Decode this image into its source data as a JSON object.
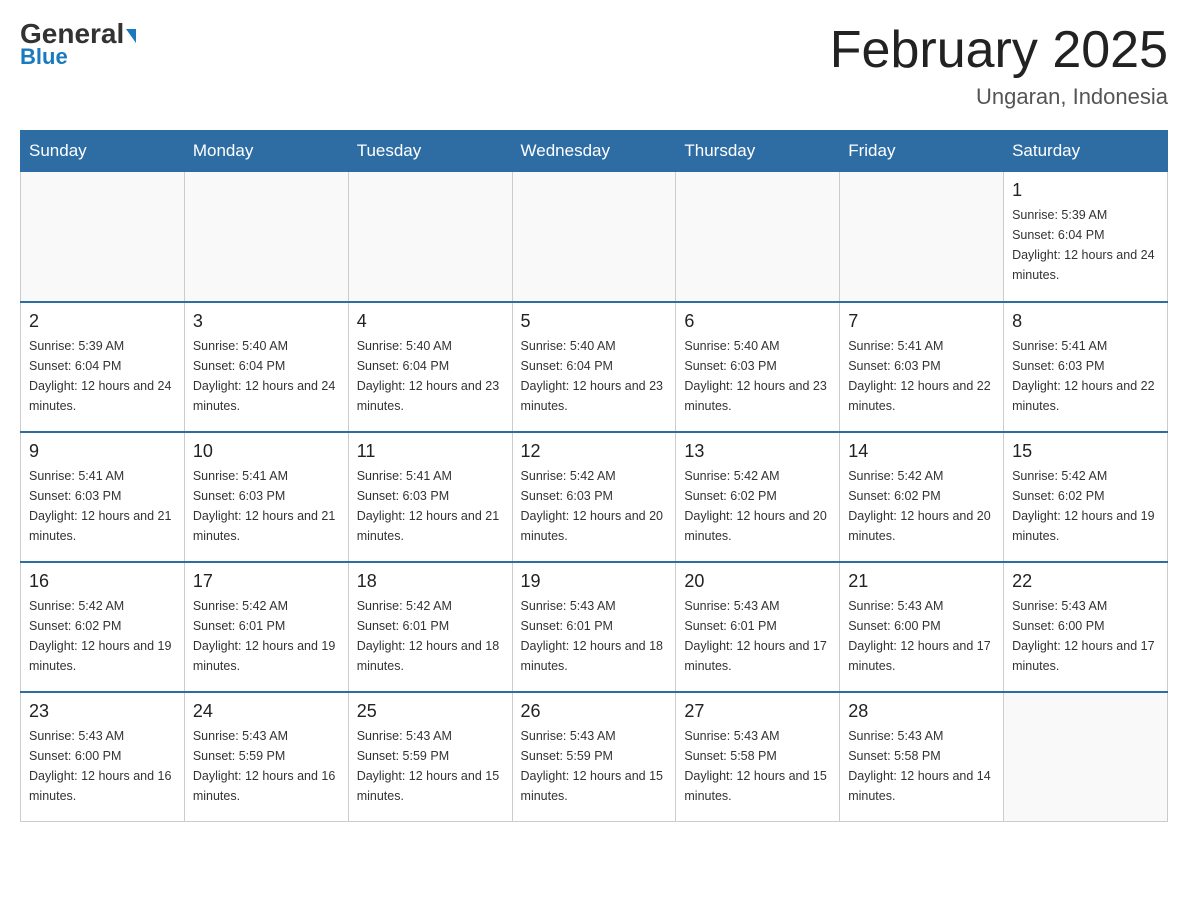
{
  "header": {
    "logo_general": "General",
    "logo_blue": "Blue",
    "month_title": "February 2025",
    "location": "Ungaran, Indonesia"
  },
  "days_of_week": [
    "Sunday",
    "Monday",
    "Tuesday",
    "Wednesday",
    "Thursday",
    "Friday",
    "Saturday"
  ],
  "weeks": [
    {
      "days": [
        {
          "date": "",
          "empty": true
        },
        {
          "date": "",
          "empty": true
        },
        {
          "date": "",
          "empty": true
        },
        {
          "date": "",
          "empty": true
        },
        {
          "date": "",
          "empty": true
        },
        {
          "date": "",
          "empty": true
        },
        {
          "date": "1",
          "sunrise": "5:39 AM",
          "sunset": "6:04 PM",
          "daylight": "12 hours and 24 minutes."
        }
      ]
    },
    {
      "days": [
        {
          "date": "2",
          "sunrise": "5:39 AM",
          "sunset": "6:04 PM",
          "daylight": "12 hours and 24 minutes."
        },
        {
          "date": "3",
          "sunrise": "5:40 AM",
          "sunset": "6:04 PM",
          "daylight": "12 hours and 24 minutes."
        },
        {
          "date": "4",
          "sunrise": "5:40 AM",
          "sunset": "6:04 PM",
          "daylight": "12 hours and 23 minutes."
        },
        {
          "date": "5",
          "sunrise": "5:40 AM",
          "sunset": "6:04 PM",
          "daylight": "12 hours and 23 minutes."
        },
        {
          "date": "6",
          "sunrise": "5:40 AM",
          "sunset": "6:03 PM",
          "daylight": "12 hours and 23 minutes."
        },
        {
          "date": "7",
          "sunrise": "5:41 AM",
          "sunset": "6:03 PM",
          "daylight": "12 hours and 22 minutes."
        },
        {
          "date": "8",
          "sunrise": "5:41 AM",
          "sunset": "6:03 PM",
          "daylight": "12 hours and 22 minutes."
        }
      ]
    },
    {
      "days": [
        {
          "date": "9",
          "sunrise": "5:41 AM",
          "sunset": "6:03 PM",
          "daylight": "12 hours and 21 minutes."
        },
        {
          "date": "10",
          "sunrise": "5:41 AM",
          "sunset": "6:03 PM",
          "daylight": "12 hours and 21 minutes."
        },
        {
          "date": "11",
          "sunrise": "5:41 AM",
          "sunset": "6:03 PM",
          "daylight": "12 hours and 21 minutes."
        },
        {
          "date": "12",
          "sunrise": "5:42 AM",
          "sunset": "6:03 PM",
          "daylight": "12 hours and 20 minutes."
        },
        {
          "date": "13",
          "sunrise": "5:42 AM",
          "sunset": "6:02 PM",
          "daylight": "12 hours and 20 minutes."
        },
        {
          "date": "14",
          "sunrise": "5:42 AM",
          "sunset": "6:02 PM",
          "daylight": "12 hours and 20 minutes."
        },
        {
          "date": "15",
          "sunrise": "5:42 AM",
          "sunset": "6:02 PM",
          "daylight": "12 hours and 19 minutes."
        }
      ]
    },
    {
      "days": [
        {
          "date": "16",
          "sunrise": "5:42 AM",
          "sunset": "6:02 PM",
          "daylight": "12 hours and 19 minutes."
        },
        {
          "date": "17",
          "sunrise": "5:42 AM",
          "sunset": "6:01 PM",
          "daylight": "12 hours and 19 minutes."
        },
        {
          "date": "18",
          "sunrise": "5:42 AM",
          "sunset": "6:01 PM",
          "daylight": "12 hours and 18 minutes."
        },
        {
          "date": "19",
          "sunrise": "5:43 AM",
          "sunset": "6:01 PM",
          "daylight": "12 hours and 18 minutes."
        },
        {
          "date": "20",
          "sunrise": "5:43 AM",
          "sunset": "6:01 PM",
          "daylight": "12 hours and 17 minutes."
        },
        {
          "date": "21",
          "sunrise": "5:43 AM",
          "sunset": "6:00 PM",
          "daylight": "12 hours and 17 minutes."
        },
        {
          "date": "22",
          "sunrise": "5:43 AM",
          "sunset": "6:00 PM",
          "daylight": "12 hours and 17 minutes."
        }
      ]
    },
    {
      "days": [
        {
          "date": "23",
          "sunrise": "5:43 AM",
          "sunset": "6:00 PM",
          "daylight": "12 hours and 16 minutes."
        },
        {
          "date": "24",
          "sunrise": "5:43 AM",
          "sunset": "5:59 PM",
          "daylight": "12 hours and 16 minutes."
        },
        {
          "date": "25",
          "sunrise": "5:43 AM",
          "sunset": "5:59 PM",
          "daylight": "12 hours and 15 minutes."
        },
        {
          "date": "26",
          "sunrise": "5:43 AM",
          "sunset": "5:59 PM",
          "daylight": "12 hours and 15 minutes."
        },
        {
          "date": "27",
          "sunrise": "5:43 AM",
          "sunset": "5:58 PM",
          "daylight": "12 hours and 15 minutes."
        },
        {
          "date": "28",
          "sunrise": "5:43 AM",
          "sunset": "5:58 PM",
          "daylight": "12 hours and 14 minutes."
        },
        {
          "date": "",
          "empty": true
        }
      ]
    }
  ]
}
